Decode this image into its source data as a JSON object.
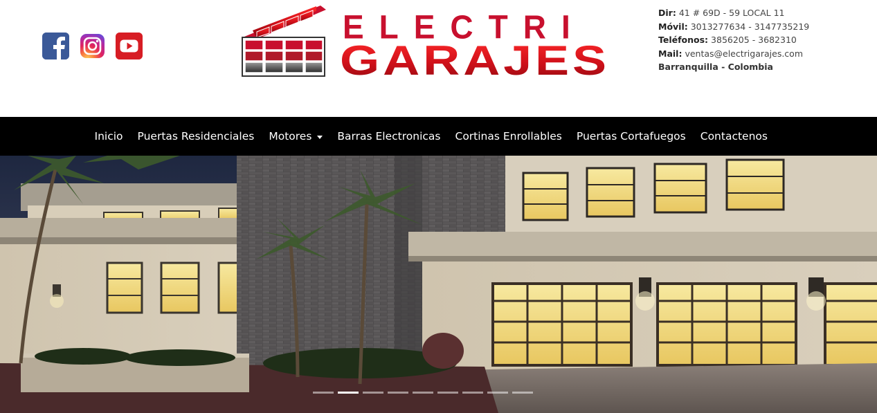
{
  "social": {
    "icons": [
      "facebook-icon",
      "instagram-icon",
      "youtube-icon"
    ],
    "colors": {
      "facebook": "#3b5998",
      "youtube": "#d71d24"
    }
  },
  "logo": {
    "line1": "ELECTRI",
    "line2": "GARAJES",
    "brand_red": "#c8102e"
  },
  "contact": {
    "dir_label": "Dir:",
    "dir_value": "41 # 69D - 59 LOCAL 11",
    "movil_label": "Móvil:",
    "movil_value": "3013277634 - 3147735219",
    "tel_label": "Teléfonos:",
    "tel_value": "3856205 - 3682310",
    "mail_label": "Mail:",
    "mail_value": "ventas@electrigarajes.com",
    "city": "Barranquilla - Colombia"
  },
  "nav": {
    "items": [
      {
        "label": "Inicio"
      },
      {
        "label": "Puertas Residenciales"
      },
      {
        "label": "Motores",
        "dropdown": true
      },
      {
        "label": "Barras Electronicas"
      },
      {
        "label": "Cortinas Enrollables"
      },
      {
        "label": "Puertas Cortafuegos"
      },
      {
        "label": "Contactenos"
      }
    ]
  },
  "carousel": {
    "slide_count": 9,
    "active_index": 1
  }
}
